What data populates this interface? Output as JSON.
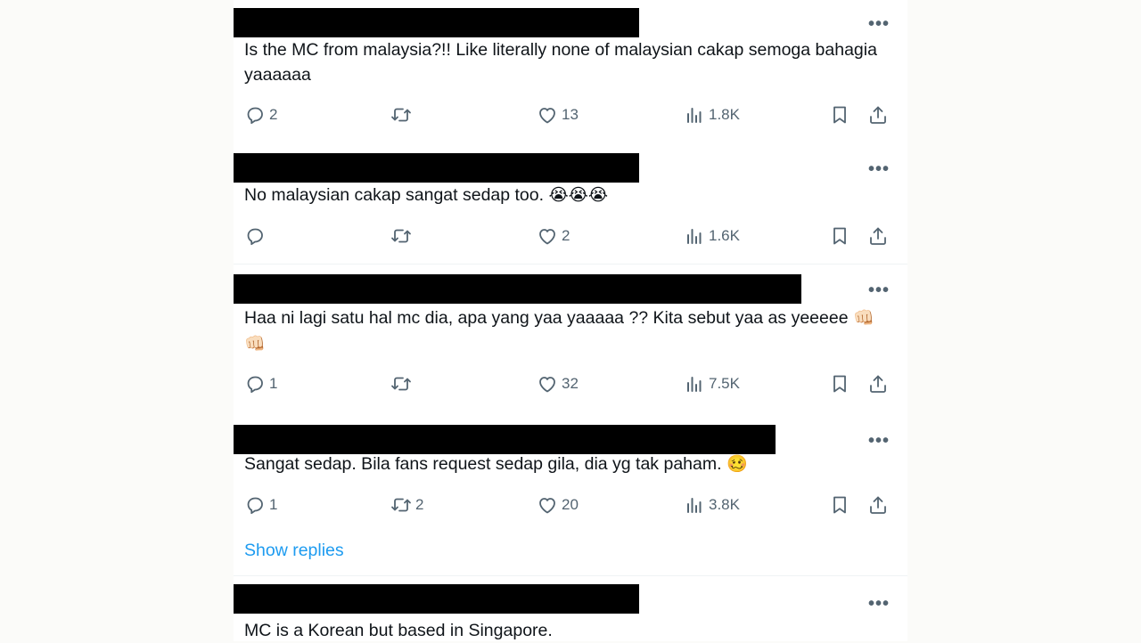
{
  "tweets": [
    {
      "text": "Is the MC from malaysia?!! Like literally none of malaysian cakap semoga bahagia yaaaaaa",
      "emoji": "",
      "replies": "2",
      "retweets": "",
      "likes": "13",
      "views": "1.8K"
    },
    {
      "text": "No malaysian cakap sangat sedap too. ",
      "emoji": "😭😭😭",
      "replies": "",
      "retweets": "",
      "likes": "2",
      "views": "1.6K"
    },
    {
      "text": "Haa ni lagi satu hal mc dia, apa yang yaa yaaaaa ?? Kita sebut yaa as yeeeee ",
      "emoji": "👊🏻 👊🏻",
      "replies": "1",
      "retweets": "",
      "likes": "32",
      "views": "7.5K"
    },
    {
      "text": "Sangat sedap. Bila fans request sedap gila, dia yg tak paham. ",
      "emoji": "🥴",
      "replies": "1",
      "retweets": "2",
      "likes": "20",
      "views": "3.8K"
    },
    {
      "text": "MC is a Korean but based in Singapore.",
      "emoji": ""
    }
  ],
  "show_replies": "Show replies",
  "more_glyph": "•••",
  "icons": {
    "reply": "reply-icon",
    "retweet": "retweet-icon",
    "like": "heart-icon",
    "views": "views-icon",
    "bookmark": "bookmark-icon",
    "share": "share-icon",
    "more": "more-icon"
  },
  "colors": {
    "link": "#1d9bf0",
    "icon": "#536471",
    "text": "#0f1419"
  }
}
